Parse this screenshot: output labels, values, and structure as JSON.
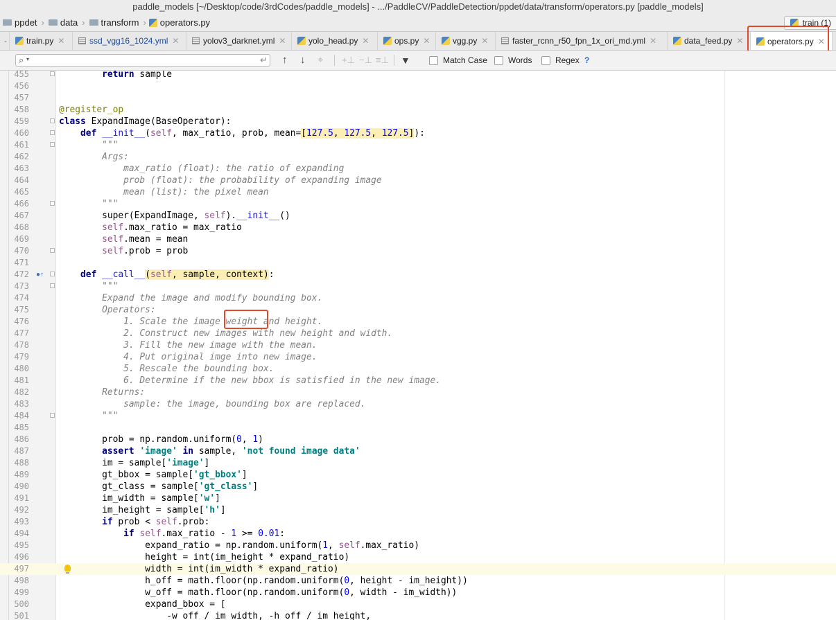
{
  "window": {
    "title": "paddle_models [~/Desktop/code/3rdCodes/paddle_models] - .../PaddleCV/PaddleDetection/ppdet/data/transform/operators.py [paddle_models]"
  },
  "breadcrumb": [
    "ppdet",
    "data",
    "transform",
    "operators.py"
  ],
  "run_config": "train (1)",
  "tabs": [
    {
      "label": "train.py",
      "icon": "python-file-icon"
    },
    {
      "label": "ssd_vgg16_1024.yml",
      "icon": "yaml-file-icon"
    },
    {
      "label": "yolov3_darknet.yml",
      "icon": "yaml-file-icon"
    },
    {
      "label": "yolo_head.py",
      "icon": "python-file-icon"
    },
    {
      "label": "ops.py",
      "icon": "python-file-icon"
    },
    {
      "label": "vgg.py",
      "icon": "python-file-icon"
    },
    {
      "label": "faster_rcnn_r50_fpn_1x_ori_md.yml",
      "icon": "yaml-file-icon"
    },
    {
      "label": "data_feed.py",
      "icon": "python-file-icon"
    },
    {
      "label": "operators.py",
      "icon": "python-file-icon",
      "active": true
    }
  ],
  "search": {
    "value": "",
    "options": [
      {
        "label": "Match Case",
        "checked": false
      },
      {
        "label": "Words",
        "checked": false
      },
      {
        "label": "Regex",
        "checked": false
      }
    ],
    "help": "?"
  },
  "editor": {
    "current_line": "497",
    "lines": [
      {
        "n": "455",
        "text": "        return sample"
      },
      {
        "n": "456",
        "text": ""
      },
      {
        "n": "457",
        "text": ""
      },
      {
        "n": "458",
        "text": "@register_op"
      },
      {
        "n": "459",
        "text": "class ExpandImage(BaseOperator):"
      },
      {
        "n": "460",
        "text": "    def __init__(self, max_ratio, prob, mean=[127.5, 127.5, 127.5]):"
      },
      {
        "n": "461",
        "text": "        \"\"\""
      },
      {
        "n": "462",
        "text": "        Args:"
      },
      {
        "n": "463",
        "text": "            max_ratio (float): the ratio of expanding"
      },
      {
        "n": "464",
        "text": "            prob (float): the probability of expanding image"
      },
      {
        "n": "465",
        "text": "            mean (list): the pixel mean"
      },
      {
        "n": "466",
        "text": "        \"\"\""
      },
      {
        "n": "467",
        "text": "        super(ExpandImage, self).__init__()"
      },
      {
        "n": "468",
        "text": "        self.max_ratio = max_ratio"
      },
      {
        "n": "469",
        "text": "        self.mean = mean"
      },
      {
        "n": "470",
        "text": "        self.prob = prob"
      },
      {
        "n": "471",
        "text": ""
      },
      {
        "n": "472",
        "text": "    def __call__(self, sample, context):"
      },
      {
        "n": "473",
        "text": "        \"\"\""
      },
      {
        "n": "474",
        "text": "        Expand the image and modify bounding box."
      },
      {
        "n": "475",
        "text": "        Operators:"
      },
      {
        "n": "476",
        "text": "            1. Scale the image weight and height."
      },
      {
        "n": "477",
        "text": "            2. Construct new images with new height and width."
      },
      {
        "n": "478",
        "text": "            3. Fill the new image with the mean."
      },
      {
        "n": "479",
        "text": "            4. Put original imge into new image."
      },
      {
        "n": "480",
        "text": "            5. Rescale the bounding box."
      },
      {
        "n": "481",
        "text": "            6. Determine if the new bbox is satisfied in the new image."
      },
      {
        "n": "482",
        "text": "        Returns:"
      },
      {
        "n": "483",
        "text": "            sample: the image, bounding box are replaced."
      },
      {
        "n": "484",
        "text": "        \"\"\""
      },
      {
        "n": "485",
        "text": ""
      },
      {
        "n": "486",
        "text": "        prob = np.random.uniform(0, 1)"
      },
      {
        "n": "487",
        "text": "        assert 'image' in sample, 'not found image data'"
      },
      {
        "n": "488",
        "text": "        im = sample['image']"
      },
      {
        "n": "489",
        "text": "        gt_bbox = sample['gt_bbox']"
      },
      {
        "n": "490",
        "text": "        gt_class = sample['gt_class']"
      },
      {
        "n": "491",
        "text": "        im_width = sample['w']"
      },
      {
        "n": "492",
        "text": "        im_height = sample['h']"
      },
      {
        "n": "493",
        "text": "        if prob < self.prob:"
      },
      {
        "n": "494",
        "text": "            if self.max_ratio - 1 >= 0.01:"
      },
      {
        "n": "495",
        "text": "                expand_ratio = np.random.uniform(1, self.max_ratio)"
      },
      {
        "n": "496",
        "text": "                height = int(im_height * expand_ratio)"
      },
      {
        "n": "497",
        "text": "                width = int(im_width * expand_ratio)"
      },
      {
        "n": "498",
        "text": "                h_off = math.floor(np.random.uniform(0, height - im_height))"
      },
      {
        "n": "499",
        "text": "                w_off = math.floor(np.random.uniform(0, width - im_width))"
      },
      {
        "n": "500",
        "text": "                expand_bbox = ["
      },
      {
        "n": "501",
        "text": "                    -w_off / im_width, -h_off / im_height,"
      }
    ]
  },
  "colors": {
    "keyword": "#000080",
    "string": "#008080",
    "number": "#0000ff",
    "comment": "#808080",
    "self": "#94558d",
    "annotation": "#e0492d",
    "current_line": "#fdfbe4"
  }
}
